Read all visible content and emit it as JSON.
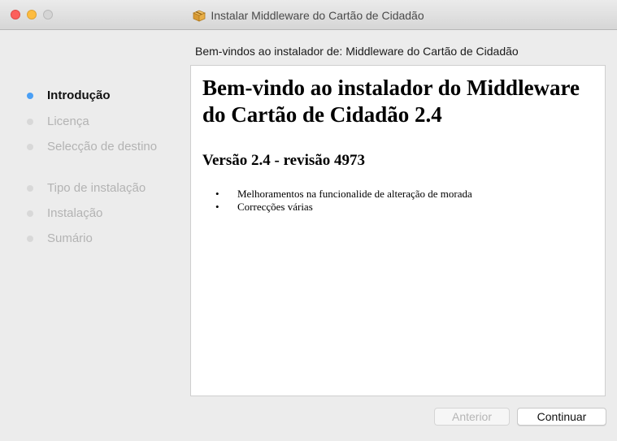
{
  "window": {
    "title": "Instalar Middleware do Cartão de Cidadão"
  },
  "header": {
    "subtitle": "Bem-vindos ao instalador de: Middleware do Cartão de Cidadão"
  },
  "steps": [
    {
      "label": "Introdução",
      "active": true
    },
    {
      "label": "Licença",
      "active": false
    },
    {
      "label": "Selecção de destino",
      "active": false
    },
    {
      "label": "Tipo de instalação",
      "active": false
    },
    {
      "label": "Instalação",
      "active": false
    },
    {
      "label": "Sumário",
      "active": false
    }
  ],
  "content": {
    "heading": "Bem-vindo ao instalador do Middleware do Cartão de Cidadão 2.4",
    "version": "Versão 2.4 - revisão 4973",
    "bullets": [
      "Melhoramentos na funcionalide de alteração de morada",
      "Correcções várias"
    ],
    "bullet_glyph": "•"
  },
  "buttons": {
    "back": "Anterior",
    "continue": "Continuar"
  },
  "colors": {
    "active_step_dot": "#4a9ff5",
    "close": "#fc605c",
    "minimize": "#fdbc40"
  }
}
